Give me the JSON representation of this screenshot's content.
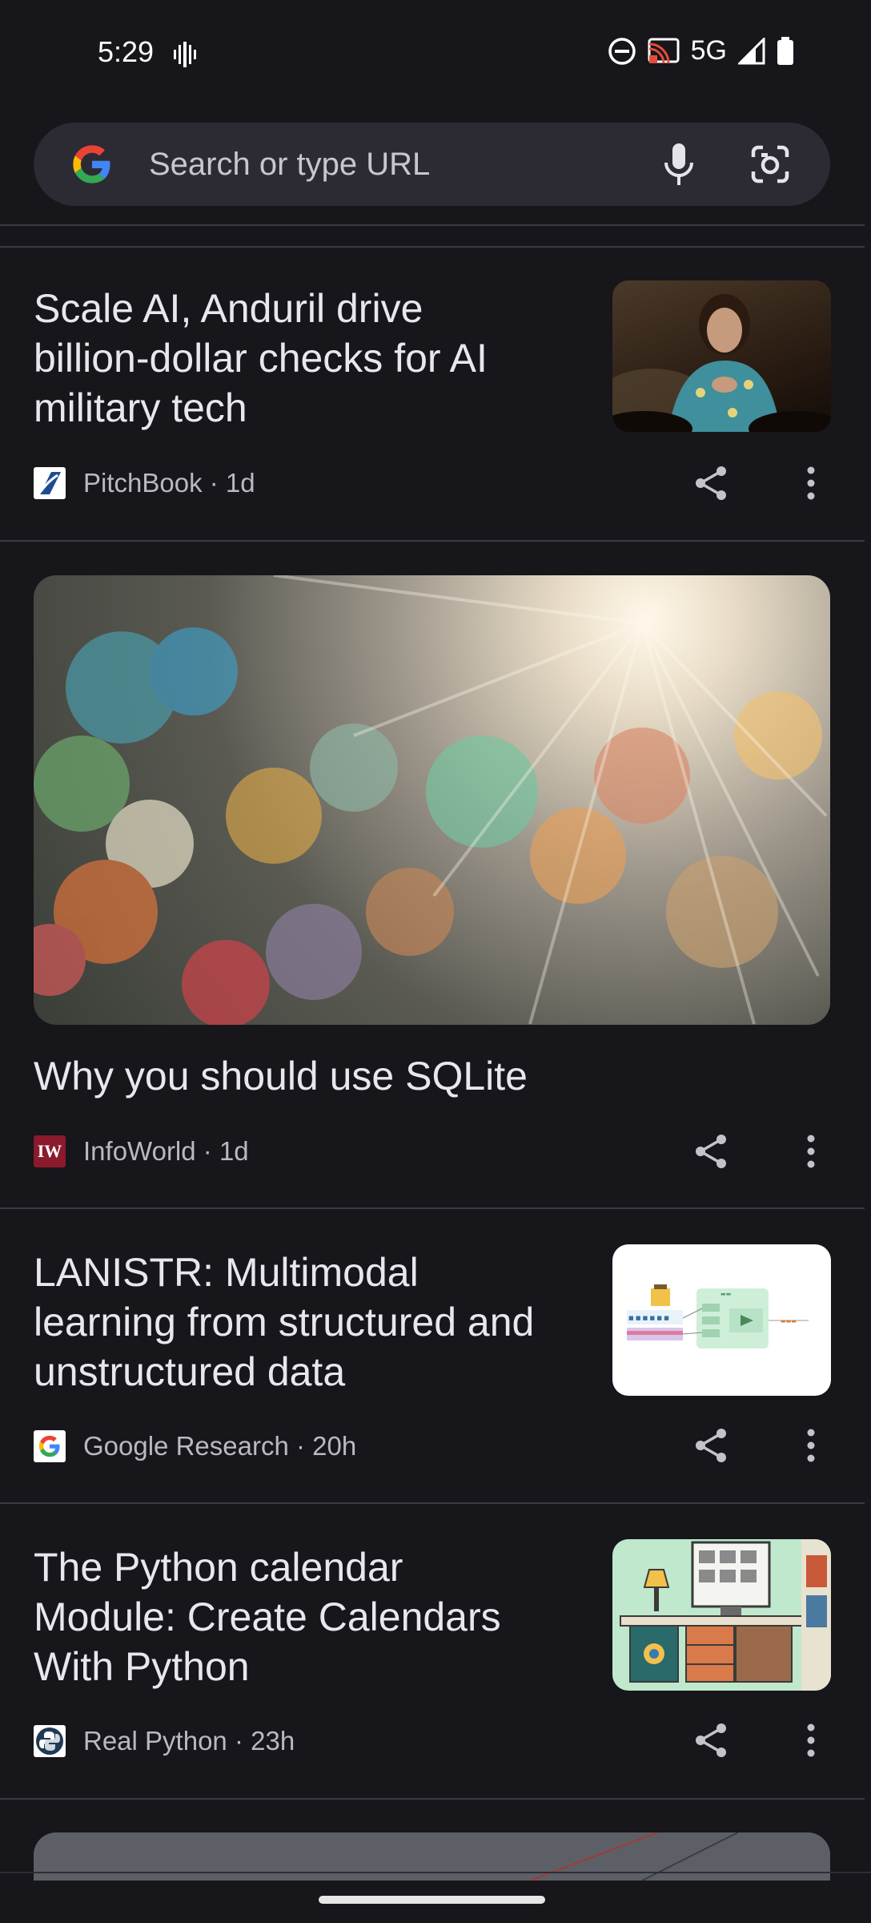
{
  "status_bar": {
    "time": "5:29",
    "network": "5G"
  },
  "search": {
    "placeholder": "Search or type URL"
  },
  "articles": [
    {
      "title_lines": [
        "Scale AI, Anduril drive",
        "billion-dollar checks for AI",
        "military tech"
      ],
      "source": "PitchBook",
      "age": "1d",
      "thumbnail": "person-on-stage"
    },
    {
      "title_lines": [
        "Why you should use SQLite"
      ],
      "source": "InfoWorld",
      "age": "1d",
      "thumbnail": "bokeh-light-rays"
    },
    {
      "title_lines": [
        "LANISTR: Multimodal",
        "learning from structured and",
        "unstructured data"
      ],
      "source": "Google Research",
      "age": "20h",
      "thumbnail": "architecture-diagram"
    },
    {
      "title_lines": [
        "The Python calendar",
        "Module: Create Calendars",
        "With Python"
      ],
      "source": "Real Python",
      "age": "23h",
      "thumbnail": "desk-with-calendar"
    }
  ],
  "icons": [
    "google-g-icon",
    "microphone-icon",
    "google-lens-icon",
    "share-icon",
    "more-vert-icon",
    "vibrate-icon",
    "do-not-disturb-icon",
    "cast-icon",
    "signal-icon",
    "battery-icon"
  ],
  "colors": {
    "background": "#16161b",
    "search_bg": "#2c2b34",
    "text": "#e9e6ee",
    "subtext": "#bcb8c2",
    "divider": "#3a3a42"
  }
}
